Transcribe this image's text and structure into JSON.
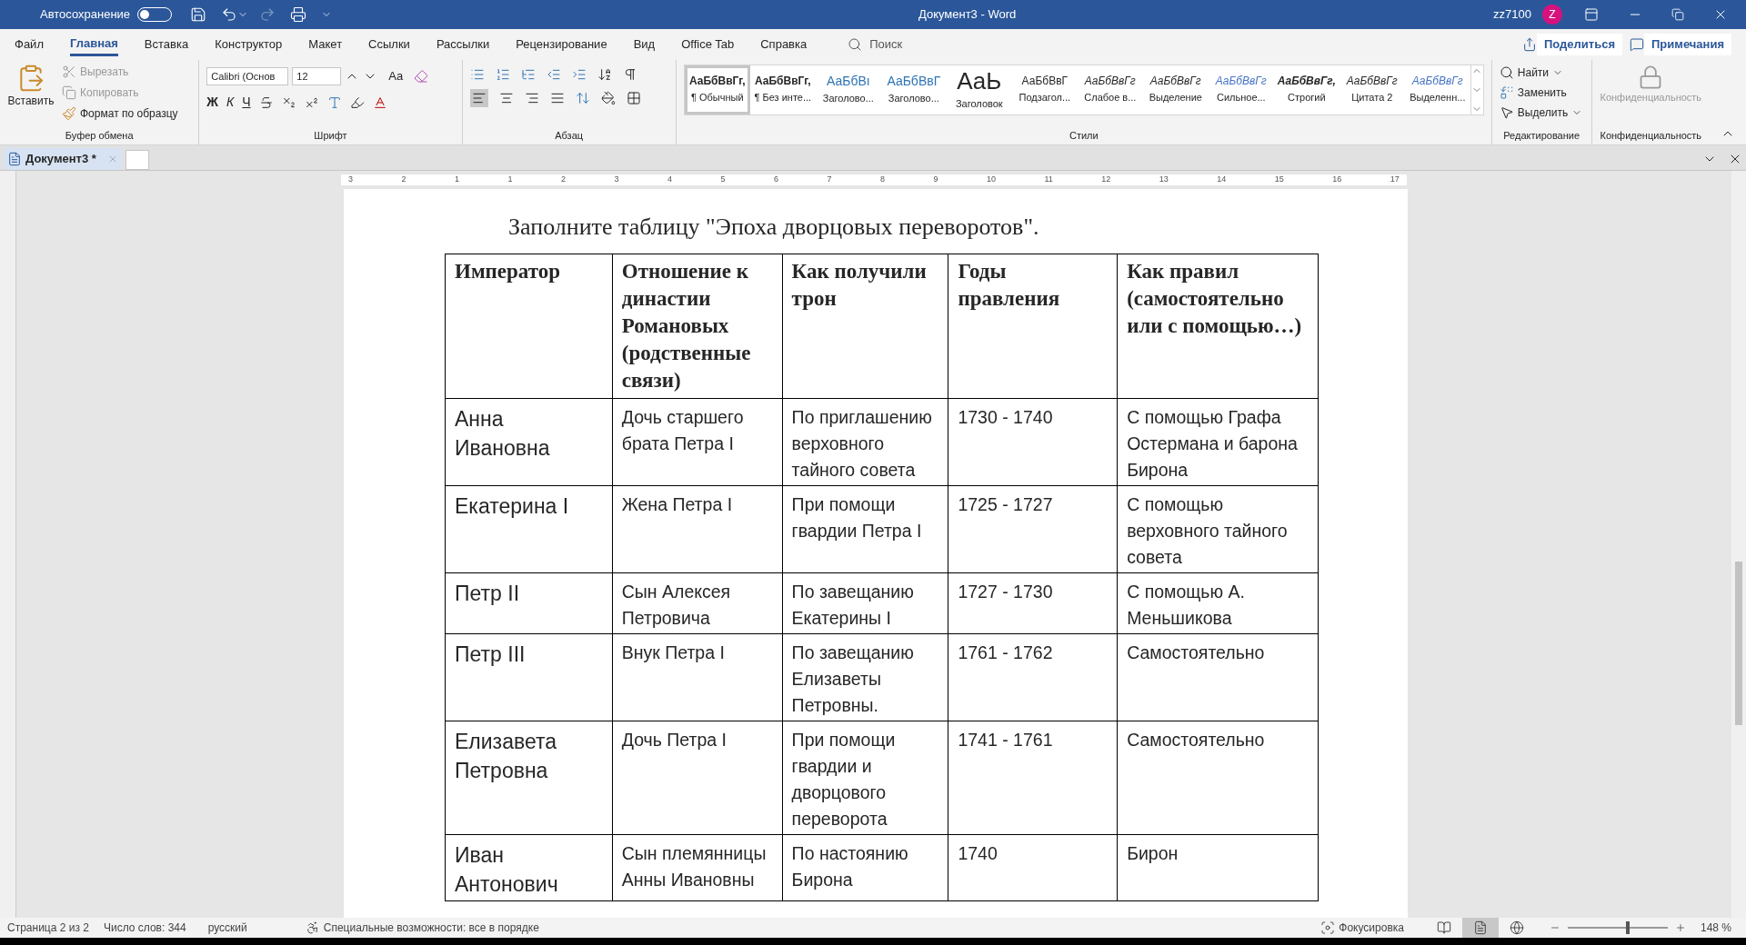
{
  "title_bar": {
    "autosave_label": "Автосохранение",
    "autosave_on": false,
    "title": "Документ3  -  Word",
    "user": "zz7100",
    "avatar": "Z"
  },
  "menu_tabs": [
    {
      "label": "Файл",
      "selected": false
    },
    {
      "label": "Главная",
      "selected": true
    },
    {
      "label": "Вставка",
      "selected": false
    },
    {
      "label": "Конструктор",
      "selected": false
    },
    {
      "label": "Макет",
      "selected": false
    },
    {
      "label": "Ссылки",
      "selected": false
    },
    {
      "label": "Рассылки",
      "selected": false
    },
    {
      "label": "Рецензирование",
      "selected": false
    },
    {
      "label": "Вид",
      "selected": false
    },
    {
      "label": "Office Tab",
      "selected": false
    },
    {
      "label": "Справка",
      "selected": false
    }
  ],
  "search": {
    "placeholder": "Поиск"
  },
  "share_button": "Поделиться",
  "comments_button": "Примечания",
  "clipboard": {
    "paste": "Вставить",
    "cut": "Вырезать",
    "copy": "Копировать",
    "format_painter": "Формат по образцу",
    "group": "Буфер обмена"
  },
  "font": {
    "name": "Calibri (Основ",
    "size": "12",
    "case": "Aa",
    "bold": "Ж",
    "italic": "К",
    "underline": "Ч",
    "group": "Шрифт"
  },
  "paragraph": {
    "group": "Абзац"
  },
  "styles": {
    "items": [
      {
        "sample": "АаБбВвГг,",
        "name": "¶ Обычный",
        "selected": true
      },
      {
        "sample": "АаБбВвГг,",
        "name": "¶ Без инте...",
        "selected": false
      },
      {
        "sample": "АаБбВı",
        "name": "Заголово...",
        "selected": false
      },
      {
        "sample": "АаБбВвГ",
        "name": "Заголово...",
        "selected": false
      },
      {
        "sample": "АаЬ",
        "name": "Заголовок",
        "selected": false
      },
      {
        "sample": "АаБбВвГ",
        "name": "Подзагол...",
        "selected": false
      },
      {
        "sample": "АаБбВвГг",
        "name": "Слабое в...",
        "selected": false
      },
      {
        "sample": "АаБбВвГг",
        "name": "Выделение",
        "selected": false
      },
      {
        "sample": "АаБбВвГг",
        "name": "Сильное...",
        "selected": false
      },
      {
        "sample": "АаБбВвГг,",
        "name": "Строгий",
        "selected": false
      },
      {
        "sample": "АаБбВвГг",
        "name": "Цитата 2",
        "selected": false
      },
      {
        "sample": "АаБбВвГг",
        "name": "Выделенн...",
        "selected": false
      }
    ],
    "group": "Стили"
  },
  "editing": {
    "find": "Найти",
    "replace": "Заменить",
    "select": "Выделить",
    "group": "Редактирование"
  },
  "privacy": {
    "button": "Конфиденциальность",
    "group": "Конфиденциальность"
  },
  "doc_tab": {
    "label": "Документ3 *"
  },
  "ruler_numbers": [
    "3",
    "2",
    "1",
    "1",
    "2",
    "3",
    "4",
    "5",
    "6",
    "7",
    "8",
    "9",
    "10",
    "11",
    "12",
    "13",
    "14",
    "15",
    "16",
    "17"
  ],
  "document": {
    "heading": "Заполните таблицу \"Эпоха дворцовых переворотов\".",
    "columns": [
      "Император",
      "Отношение к династии Романовых (родственные связи)",
      "Как получили трон",
      "Годы правления",
      "Как правил (самостоятельно или с помощью…)"
    ],
    "rows": [
      [
        "Анна Ивановна",
        "Дочь старшего брата Петра I",
        "По приглашению верховного тайного совета",
        "1730 - 1740",
        "С помощью Графа Остермана и барона Бирона"
      ],
      [
        "Екатерина I",
        "Жена Петра I",
        "При помощи гвардии Петра I",
        "1725 - 1727",
        "С помощью верховного тайного совета"
      ],
      [
        "Петр II",
        "Сын Алексея Петровича",
        "По завещанию Екатерины I",
        "1727 - 1730",
        "С помощью А. Меньшикова"
      ],
      [
        "Петр III",
        "Внук Петра I",
        "По завещанию Елизаветы Петровны.",
        "1761 - 1762",
        "Самостоятельно"
      ],
      [
        "Елизавета Петровна",
        "Дочь Петра I",
        "При помощи гвардии и дворцового переворота",
        "1741 - 1761",
        "Самостоятельно"
      ],
      [
        "Иван Антонович",
        "Сын племянницы Анны Ивановны",
        "По настоянию Бирона",
        "1740",
        "Бирон"
      ]
    ]
  },
  "status_bar": {
    "page": "Страница 2 из 2",
    "words": "Число слов: 344",
    "language": "русский",
    "accessibility": "Специальные возможности: все в порядке",
    "focus": "Фокусировка",
    "views": [
      {
        "selected": false
      },
      {
        "selected": true
      },
      {
        "selected": false
      }
    ],
    "zoom": "148 %",
    "zoom_slider": {
      "level": 0.6
    }
  }
}
